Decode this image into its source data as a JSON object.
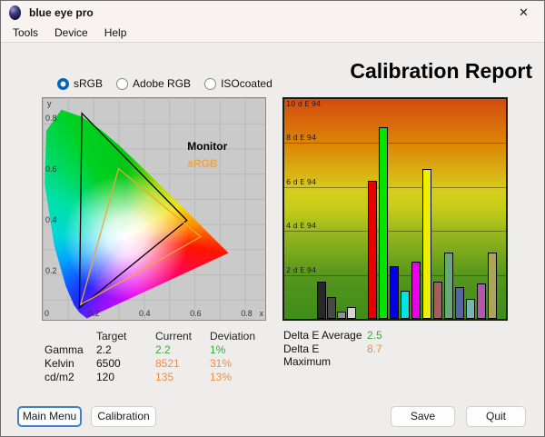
{
  "window": {
    "title": "blue eye pro",
    "close_glyph": "✕"
  },
  "menu": {
    "items": [
      "Tools",
      "Device",
      "Help"
    ]
  },
  "profile_options": [
    {
      "label": "sRGB",
      "selected": true
    },
    {
      "label": "Adobe RGB",
      "selected": false
    },
    {
      "label": "ISOcoated",
      "selected": false
    }
  ],
  "report": {
    "title": "Calibration Report"
  },
  "measurements": {
    "columns": [
      "Target",
      "Current",
      "Deviation"
    ],
    "rows": [
      {
        "label": "Gamma",
        "target": "2.2",
        "current": "2.2",
        "deviation": "1%",
        "status": "good"
      },
      {
        "label": "Kelvin",
        "target": "6500",
        "current": "8521",
        "deviation": "31%",
        "status": "warn"
      },
      {
        "label": "cd/m2",
        "target": "120",
        "current": "135",
        "deviation": "13%",
        "status": "warn"
      }
    ]
  },
  "delta_e": {
    "average_label": "Delta E Average",
    "average_value": "2.5",
    "maximum_label": "Delta E Maximum",
    "maximum_value": "8.7"
  },
  "buttons": {
    "main_menu": "Main Menu",
    "calibration": "Calibration",
    "save": "Save",
    "quit": "Quit"
  },
  "colors": {
    "good": "#3aa83a",
    "warn": "#ef8f43",
    "accent_blue": "#0067c0",
    "srgb_orange": "#f0a43c"
  },
  "chart_data": [
    {
      "type": "bar",
      "title": "Delta E 94 per color patch",
      "categories": [
        "black",
        "dark-gray",
        "gray",
        "light-gray",
        "red",
        "green",
        "blue",
        "cyan",
        "magenta",
        "yellow",
        "brown",
        "sea-green",
        "slate-blue",
        "teal",
        "orchid",
        "khaki"
      ],
      "values": [
        1.7,
        1.0,
        0.35,
        0.55,
        6.3,
        8.7,
        2.4,
        1.3,
        2.6,
        6.8,
        1.7,
        3.0,
        1.45,
        0.9,
        1.6,
        3.0
      ],
      "bar_colors": [
        "#282828",
        "#484848",
        "#909090",
        "#d4d4d4",
        "#e80000",
        "#00e400",
        "#0000e8",
        "#00e4e4",
        "#e800e8",
        "#eeee00",
        "#a85c5c",
        "#68a878",
        "#5464a4",
        "#78b4b4",
        "#b058ac",
        "#aca458"
      ],
      "ylim": [
        0,
        10
      ],
      "y_gridlines": [
        {
          "value": 10,
          "label": "10 d E 94"
        },
        {
          "value": 8,
          "label": "8 d E 94"
        },
        {
          "value": 6,
          "label": "6 d E 94"
        },
        {
          "value": 4,
          "label": "4 d E 94"
        },
        {
          "value": 2,
          "label": "2 d E 94"
        }
      ],
      "grid": "horizontal",
      "legend": "none"
    },
    {
      "type": "area",
      "title": "CIE 1931 xy chromaticity diagram with gamut triangles",
      "xlabel": "x",
      "ylabel": "y",
      "x_ticks": [
        0,
        0.2,
        0.4,
        0.6,
        0.8
      ],
      "y_ticks": [
        0.2,
        0.4,
        0.6,
        0.8
      ],
      "axis_max": 0.88,
      "series": [
        {
          "name": "Monitor",
          "color": "#000000",
          "vertices": [
            [
              0.155,
              0.82
            ],
            [
              0.57,
              0.395
            ],
            [
              0.145,
              0.048
            ]
          ]
        },
        {
          "name": "sRGB",
          "color": "#f0a43c",
          "vertices": [
            [
              0.3,
              0.6
            ],
            [
              0.625,
              0.33
            ],
            [
              0.15,
              0.06
            ]
          ]
        }
      ]
    }
  ]
}
